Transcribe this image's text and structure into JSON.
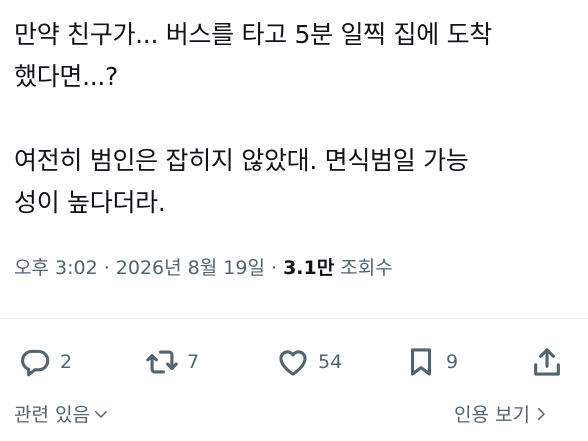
{
  "tweet": {
    "paragraph_1": "만약 친구가... 버스를 타고 5분 일찍 집에 도착\n했다면...?",
    "paragraph_2": "여전히 범인은 잡히지 않았대. 면식범일 가능\n성이 높다더라."
  },
  "meta": {
    "time": "오후 3:02",
    "separator": " · ",
    "date": "2026년 8월 19일",
    "separator_2": " · ",
    "views_count": "3.1만",
    "views_label": " 조회수"
  },
  "actions": {
    "reply": {
      "icon": "reply-icon",
      "count": "2"
    },
    "repost": {
      "icon": "repost-icon",
      "count": "7"
    },
    "like": {
      "icon": "heart-icon",
      "count": "54"
    },
    "bookmark": {
      "icon": "bookmark-icon",
      "count": "9"
    },
    "share": {
      "icon": "share-icon"
    }
  },
  "footer": {
    "relevant_label": "관련 있음",
    "quotes_label": "인용 보기"
  },
  "colors": {
    "text_primary": "#0f1419",
    "text_secondary": "#536471",
    "divider": "#eff3f4",
    "background": "#ffffff"
  }
}
